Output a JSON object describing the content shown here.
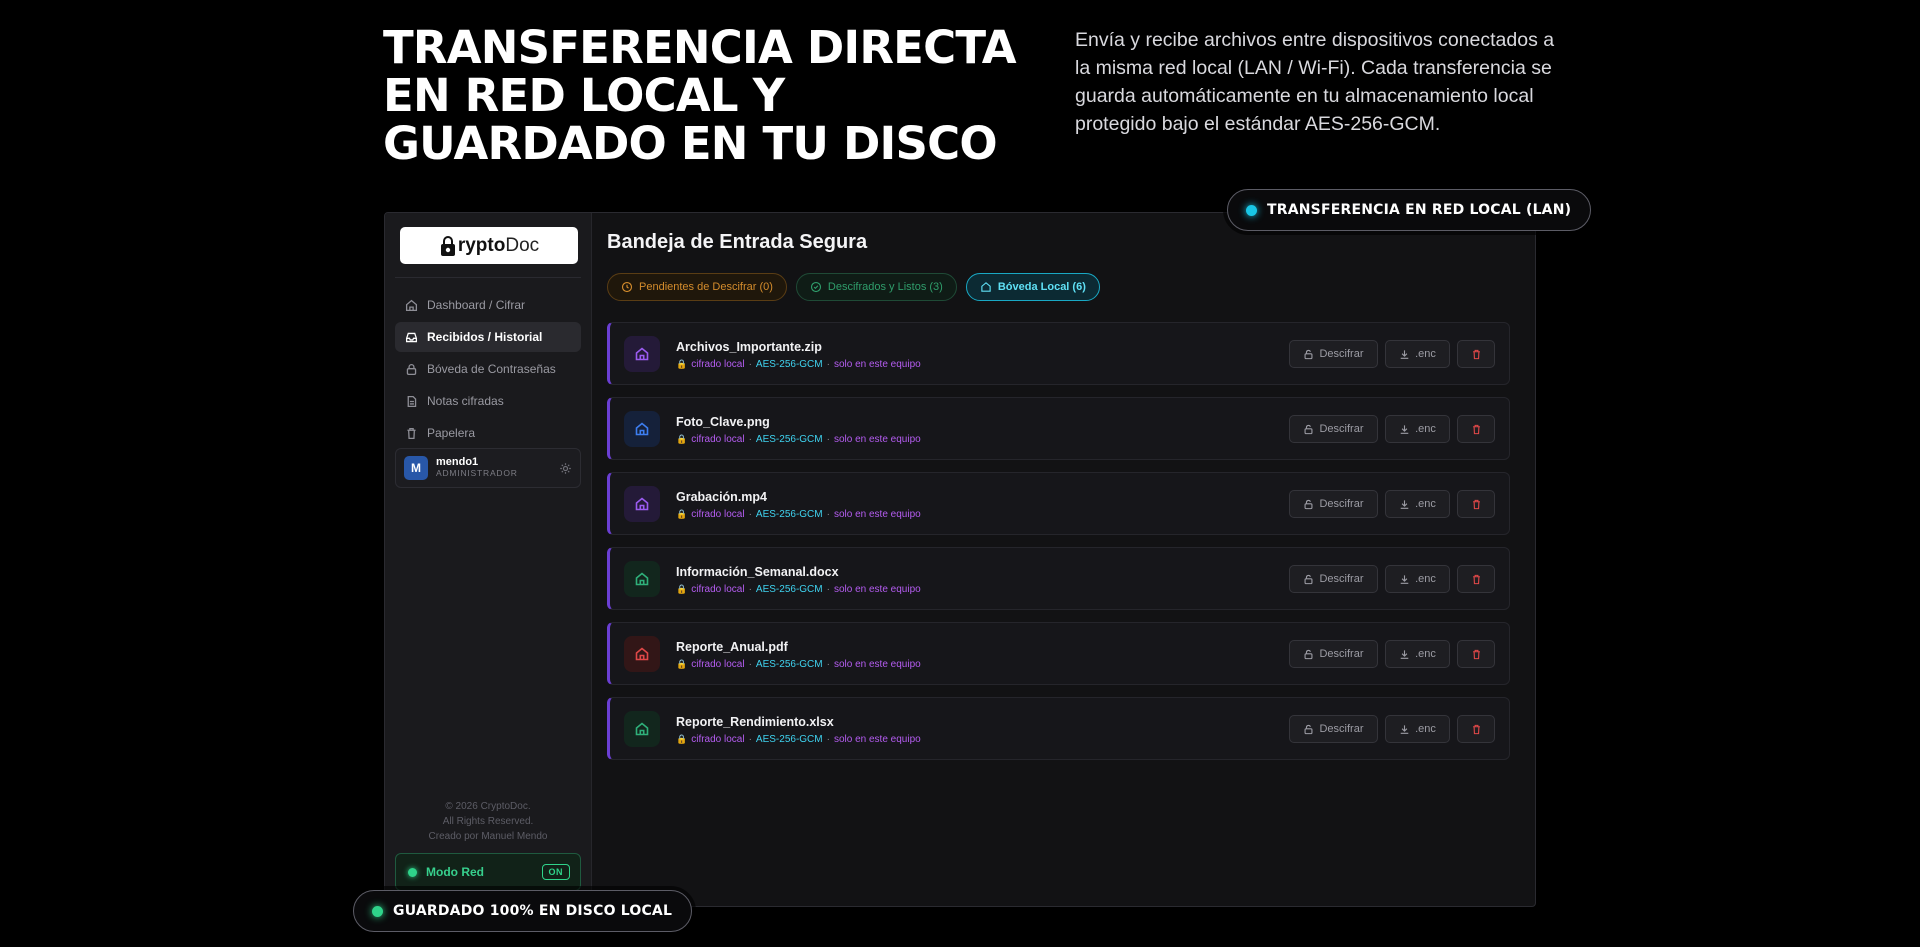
{
  "hero": {
    "title": "TRANSFERENCIA DIRECTA EN RED LOCAL Y GUARDADO EN TU DISCO",
    "description": "Envía y recibe archivos entre dispositivos conectados a la misma red local (LAN / Wi-Fi). Cada transferencia se guarda automáticamente en tu almacenamiento local protegido bajo el estándar AES-256-GCM."
  },
  "badges": {
    "lan": "TRANSFERENCIA EN RED LOCAL (LAN)",
    "disk": "GUARDADO 100% EN DISCO LOCAL"
  },
  "sidebar": {
    "logo_prefix": "rypto",
    "logo_suffix": "Doc",
    "items": [
      {
        "label": "Dashboard / Cifrar",
        "icon": "home-icon"
      },
      {
        "label": "Recibidos / Historial",
        "icon": "inbox-icon",
        "active": true
      },
      {
        "label": "Bóveda de Contraseñas",
        "icon": "lock-icon"
      },
      {
        "label": "Notas cifradas",
        "icon": "document-icon"
      },
      {
        "label": "Papelera",
        "icon": "trash-icon"
      }
    ],
    "user": {
      "initial": "M",
      "name": "mendo1",
      "role": "ADMINISTRADOR"
    },
    "footer": [
      "© 2026 CryptoDoc.",
      "All Rights Reserved.",
      "Creado por Manuel Mendo"
    ],
    "network_mode": {
      "label": "Modo Red",
      "state": "ON"
    }
  },
  "main": {
    "title": "Bandeja de Entrada Segura",
    "tabs": [
      {
        "label": "Pendientes de Descifrar (0)"
      },
      {
        "label": "Descifrados y Listos (3)"
      },
      {
        "label": "Bóveda Local (6)",
        "active": true
      }
    ],
    "meta": {
      "local": "cifrado local",
      "sep": "·",
      "algo": "AES-256-GCM",
      "device": "solo en este equipo"
    },
    "actions": {
      "decrypt": "Descifrar",
      "download": ".enc"
    },
    "files": [
      {
        "name": "Archivos_Importante.zip",
        "icon_color": "#9b5cf0",
        "icon_bg": "#241a38"
      },
      {
        "name": "Foto_Clave.png",
        "icon_color": "#3d7ef0",
        "icon_bg": "#15213a"
      },
      {
        "name": "Grabación.mp4",
        "icon_color": "#9b5cf0",
        "icon_bg": "#241a38"
      },
      {
        "name": "Información_Semanal.docx",
        "icon_color": "#2fb07a",
        "icon_bg": "#12261d"
      },
      {
        "name": "Reporte_Anual.pdf",
        "icon_color": "#e04848",
        "icon_bg": "#321617"
      },
      {
        "name": "Reporte_Rendimiento.xlsx",
        "icon_color": "#2fb07a",
        "icon_bg": "#12261d"
      }
    ]
  }
}
